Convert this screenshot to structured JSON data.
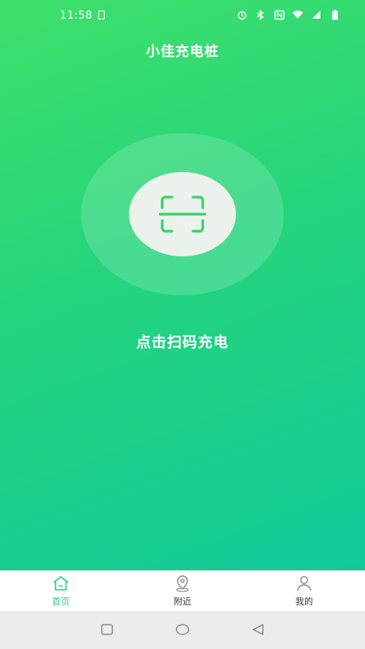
{
  "status_bar": {
    "time": "11:58",
    "icons": [
      "sim-card-icon",
      "alarm-icon",
      "bluetooth-icon",
      "nfc-icon",
      "wifi-icon",
      "signal-icon",
      "battery-icon"
    ]
  },
  "app": {
    "title": "小佳充电桩"
  },
  "scan": {
    "icon": "scan-icon",
    "label": "点击扫码充电"
  },
  "tab_bar": {
    "tabs": [
      {
        "label": "首页",
        "icon": "home-icon",
        "active": true
      },
      {
        "label": "附近",
        "icon": "location-pin-icon",
        "active": false
      },
      {
        "label": "我的",
        "icon": "user-icon",
        "active": false
      }
    ]
  },
  "nav_bar": {
    "buttons": [
      "recent-apps-icon",
      "home-circle-icon",
      "back-icon"
    ]
  },
  "colors": {
    "gradient_start": "#3fe06a",
    "gradient_end": "#10c99a",
    "accent": "#1fd08b",
    "scan_icon": "#3ccf6a"
  }
}
